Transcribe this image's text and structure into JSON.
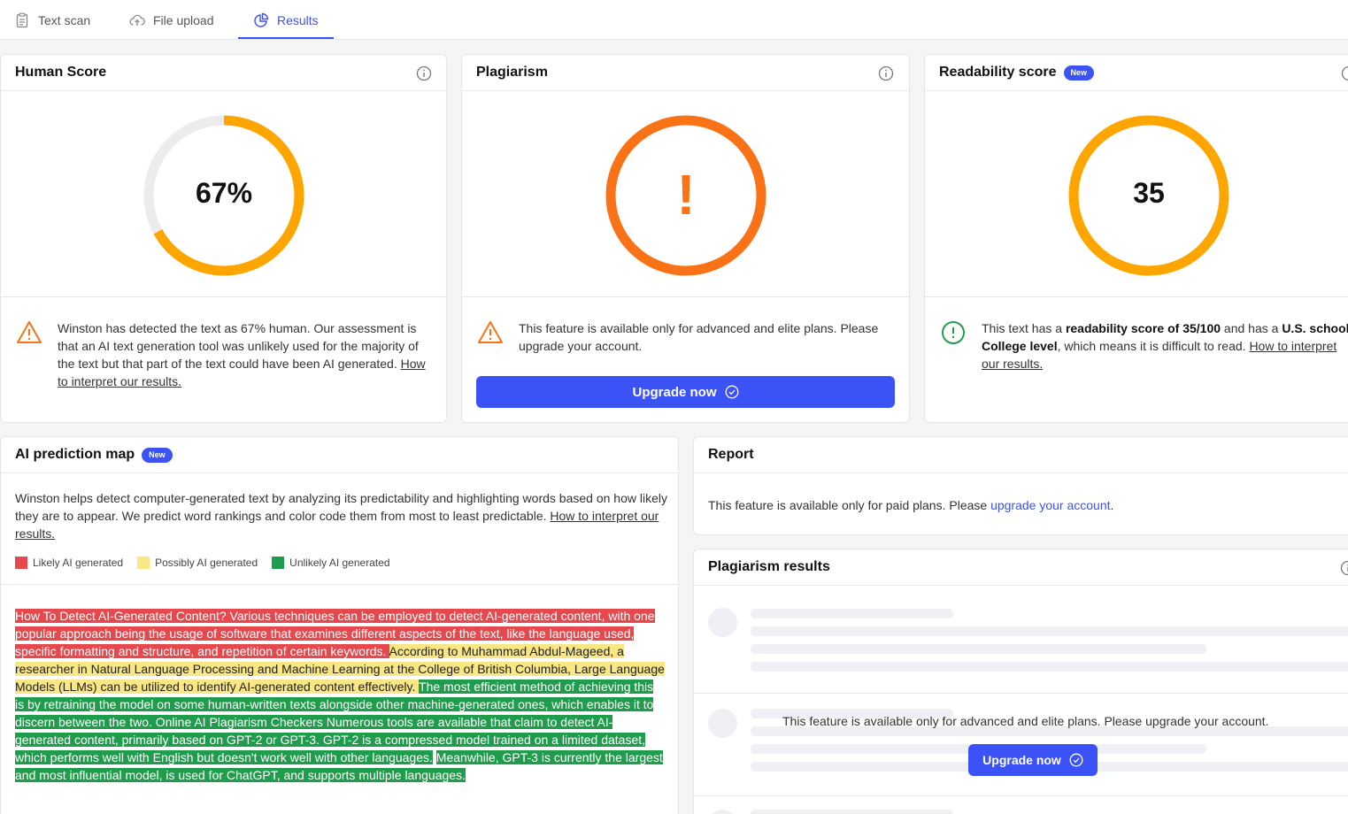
{
  "tabs": [
    {
      "label": "Text scan",
      "icon": "clipboard-icon"
    },
    {
      "label": "File upload",
      "icon": "cloud-upload-icon"
    },
    {
      "label": "Results",
      "icon": "pie-chart-icon",
      "active": true
    }
  ],
  "human_score": {
    "title": "Human Score",
    "value_text": "67%",
    "value": 67,
    "color": "#ffa500",
    "message": {
      "prefix": "Winston has detected the text as 67% human. Our assessment is that an AI text generation tool was unlikely used for the majority of the text but that part of the text could have been AI generated.",
      "link": "How to interpret our results."
    }
  },
  "plagiarism": {
    "title": "Plagiarism",
    "symbol": "!",
    "color": "#f97316",
    "message": "This feature is available only for advanced and elite plans. Please upgrade your account.",
    "button": "Upgrade now"
  },
  "readability": {
    "title": "Readability score",
    "badge": "New",
    "value_text": "35",
    "value": 35,
    "color": "#ffa500",
    "message": {
      "p1": "This text has a ",
      "b1": "readability score of 35/100",
      "p2": " and has a ",
      "b2": "U.S. school College level",
      "p3": ", which means it is difficult to read. ",
      "link": "How to interpret our results."
    }
  },
  "prediction_map": {
    "title": "AI prediction map",
    "badge": "New",
    "description": "Winston helps detect computer-generated text by analyzing its predictability and highlighting words based on how likely they are to appear. We predict word rankings and color code them from most to least predictable.",
    "link": "How to interpret our results.",
    "legend": [
      {
        "label": "Likely AI generated",
        "color": "#e5484d"
      },
      {
        "label": "Possibly AI generated",
        "color": "#f9e784"
      },
      {
        "label": "Unlikely AI generated",
        "color": "#1f9d4c"
      }
    ],
    "segments": [
      {
        "cls": "red",
        "text": " How To Detect AI-Generated Content? Various techniques can be employed to detect AI-generated content, with one popular approach being the usage of software that examines different aspects of the text, like the language used, specific formatting and structure, and repetition of certain keywords. "
      },
      {
        "cls": "yellow",
        "text": " According to Muhammad Abdul-Mageed, a researcher in Natural Language Processing and Machine Learning at the College of British Columbia, Large Language Models (LLMs) can be utilized to identify AI-generated content effectively. "
      },
      {
        "cls": "green",
        "text": "The most efficient method of achieving this is by retraining the model on some human-written texts alongside other machine-generated ones, which enables it to discern between the two. Online AI Plagiarism Checkers Numerous tools are available that claim to detect AI-generated content, primarily based on GPT-2 or GPT-3. GPT-2 is a compressed model trained on a limited dataset, which performs well with English but doesn't work well with other languages."
      },
      {
        "cls": "none",
        "text": " "
      },
      {
        "cls": "green",
        "text": "Meanwhile, GPT-3 is currently the largest and most influential model, is used for ChatGPT, and supports multiple languages."
      }
    ]
  },
  "report": {
    "title": "Report",
    "message_prefix": "This feature is available only for paid plans. Please ",
    "link": "upgrade your account",
    "message_suffix": "."
  },
  "plagiarism_results": {
    "title": "Plagiarism results",
    "message": "This feature is available only for advanced and elite plans. Please upgrade your account.",
    "button": "Upgrade now"
  }
}
